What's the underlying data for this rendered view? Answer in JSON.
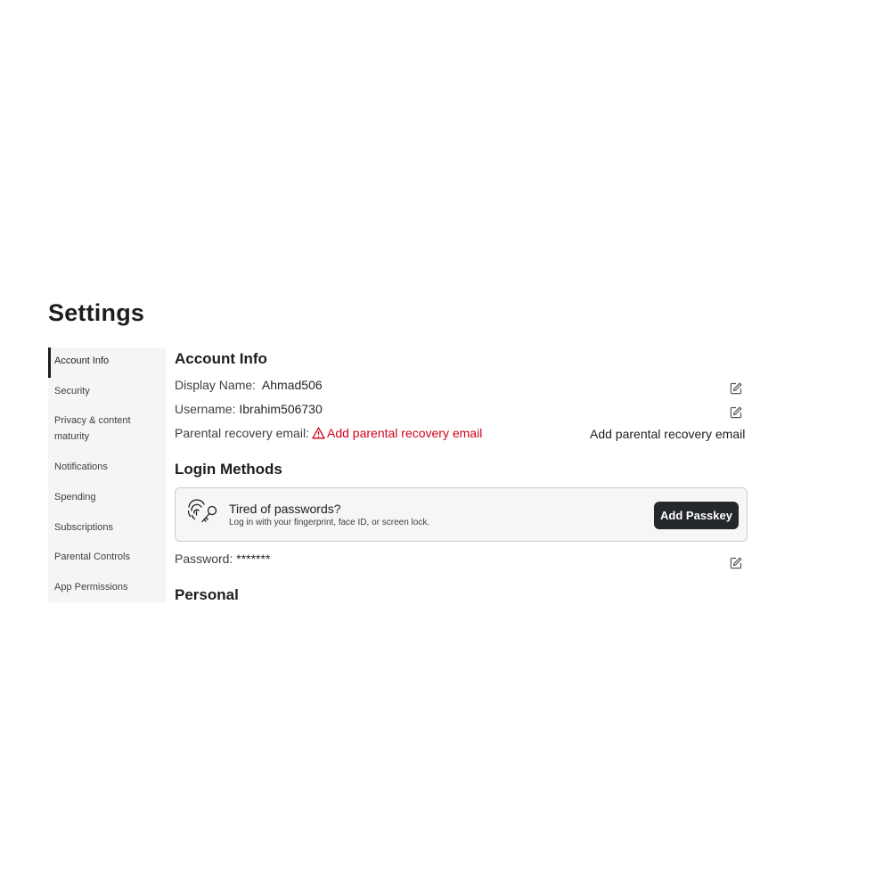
{
  "page": {
    "title": "Settings"
  },
  "sidebar": {
    "items": [
      {
        "label": "Account Info",
        "active": true
      },
      {
        "label": "Security"
      },
      {
        "label": "Privacy & content maturity"
      },
      {
        "label": "Notifications"
      },
      {
        "label": "Spending"
      },
      {
        "label": "Subscriptions"
      },
      {
        "label": "Parental Controls"
      },
      {
        "label": "App Permissions"
      }
    ]
  },
  "account_info": {
    "heading": "Account Info",
    "display_name_label": "Display Name:",
    "display_name_value": "Ahmad506",
    "username_label": "Username:",
    "username_value": "Ibrahim506730",
    "recovery_label": "Parental recovery email:",
    "recovery_warning": "Add parental recovery email",
    "recovery_action": "Add parental recovery email"
  },
  "login_methods": {
    "heading": "Login Methods",
    "passkey_title": "Tired of passwords?",
    "passkey_subtitle": "Log in with your fingerprint, face ID, or screen lock.",
    "passkey_button": "Add Passkey",
    "password_label": "Password:",
    "password_value": "*******"
  },
  "personal": {
    "heading": "Personal"
  },
  "colors": {
    "warning": "#d0021b",
    "button_bg": "#24272b",
    "sidebar_bg": "#f5f5f5"
  },
  "icons": {
    "edit": "edit-icon",
    "warning": "warning-triangle-icon",
    "passkey": "fingerprint-key-icon"
  }
}
